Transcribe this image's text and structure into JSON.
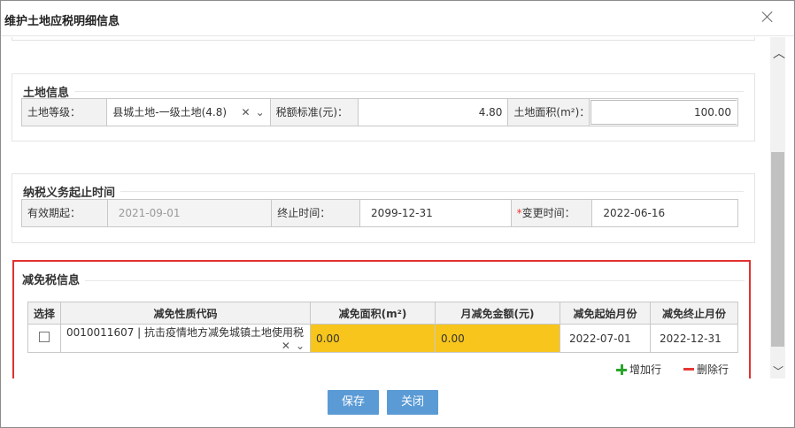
{
  "dialog": {
    "title": "维护土地应税明细信息"
  },
  "land_info": {
    "title": "土地信息",
    "grade_label": "土地等级：",
    "grade_value": "县城土地-一级土地(4.8)",
    "rate_label": "税额标准(元)：",
    "rate_value": "4.80",
    "area_label": "土地面积(m²)：",
    "area_value": "100.00"
  },
  "period": {
    "title": "纳税义务起止时间",
    "start_label": "有效期起：",
    "start_value": "2021-09-01",
    "end_label": "终止时间：",
    "end_value": "2099-12-31",
    "required_mark": "*",
    "change_label": "变更时间：",
    "change_value": "2022-06-16"
  },
  "exemption": {
    "title": "减免税信息",
    "columns": [
      "选择",
      "减免性质代码",
      "减免面积(m²)",
      "月减免金额(元)",
      "减免起始月份",
      "减免终止月份"
    ],
    "rows": [
      {
        "code": "0010011607 | 抗击疫情地方减免城镇土地使用税",
        "area": "0.00",
        "amount": "0.00",
        "start_month": "2022-07-01",
        "end_month": "2022-12-31"
      }
    ],
    "add_row_label": "增加行",
    "delete_row_label": "删除行"
  },
  "footer": {
    "save_label": "保存",
    "close_label": "关闭"
  },
  "colors": {
    "accent": "#5b9bd5",
    "highlight": "#f7c51b",
    "frame": "#e03131",
    "add": "#2aa52a",
    "delete": "#e53935"
  }
}
